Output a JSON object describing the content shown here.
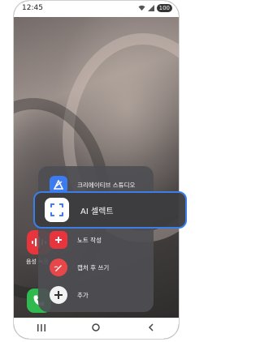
{
  "statusbar": {
    "time": "12:45",
    "battery": "100",
    "icons": [
      "wifi-icon",
      "signal-icon",
      "battery-icon"
    ]
  },
  "home": {
    "voice_recorder_label": "음성 녹음",
    "apps": [
      "voice-recorder-icon",
      "phone-app-icon"
    ]
  },
  "menu": {
    "items": [
      {
        "label": "크리에이티브 스튜디오",
        "icon": "creative-studio-icon",
        "color": "#3d7cf0"
      },
      {
        "label": "노트 작성",
        "icon": "note-add-icon",
        "color": "#e8343c"
      },
      {
        "label": "캡처 후 쓰기",
        "icon": "capture-write-icon",
        "color": "#e8474a"
      },
      {
        "label": "추가",
        "icon": "plus-icon",
        "color": "#f2f2f2"
      }
    ]
  },
  "selected": {
    "label": "AI 셀렉트",
    "icon": "ai-select-icon",
    "accent": "#3b7ee8"
  },
  "navbar": {
    "recents": "recents-icon",
    "home": "home-icon",
    "back": "back-icon"
  }
}
